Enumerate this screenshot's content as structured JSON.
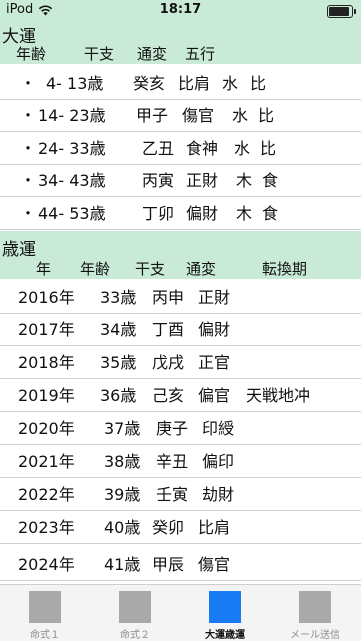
{
  "status": {
    "carrier": "iPod",
    "time": "18:17"
  },
  "daiun": {
    "title": "大運",
    "headers": [
      "年齢",
      "干支",
      "通変",
      "五行"
    ],
    "rows": [
      {
        "age": "4- 13歳",
        "kanshi": "癸亥",
        "tsuhen": "比肩",
        "gogyo": "水",
        "rel": "比"
      },
      {
        "age": "14- 23歳",
        "kanshi": "甲子",
        "tsuhen": "傷官",
        "gogyo": "水",
        "rel": "比"
      },
      {
        "age": "24- 33歳",
        "kanshi": "乙丑",
        "tsuhen": "食神",
        "gogyo": "水",
        "rel": "比"
      },
      {
        "age": "34- 43歳",
        "kanshi": "丙寅",
        "tsuhen": "正財",
        "gogyo": "木",
        "rel": "食"
      },
      {
        "age": "44- 53歳",
        "kanshi": "丁卯",
        "tsuhen": "偏財",
        "gogyo": "木",
        "rel": "食"
      }
    ]
  },
  "saiun": {
    "title": "歳運",
    "headers": [
      "年",
      "年齢",
      "干支",
      "通変",
      "転換期"
    ],
    "rows": [
      {
        "year": "2016年",
        "age": "33歳",
        "kanshi": "丙申",
        "tsuhen": "正財",
        "tenkan": ""
      },
      {
        "year": "2017年",
        "age": "34歳",
        "kanshi": "丁酉",
        "tsuhen": "偏財",
        "tenkan": ""
      },
      {
        "year": "2018年",
        "age": "35歳",
        "kanshi": "戊戌",
        "tsuhen": "正官",
        "tenkan": ""
      },
      {
        "year": "2019年",
        "age": "36歳",
        "kanshi": "己亥",
        "tsuhen": "偏官",
        "tenkan": "天戦地冲"
      },
      {
        "year": "2020年",
        "age": "37歳",
        "kanshi": "庚子",
        "tsuhen": "印綬",
        "tenkan": ""
      },
      {
        "year": "2021年",
        "age": "38歳",
        "kanshi": "辛丑",
        "tsuhen": "偏印",
        "tenkan": ""
      },
      {
        "year": "2022年",
        "age": "39歳",
        "kanshi": "壬寅",
        "tsuhen": "劫財",
        "tenkan": ""
      },
      {
        "year": "2023年",
        "age": "40歳",
        "kanshi": "癸卯",
        "tsuhen": "比肩",
        "tenkan": ""
      },
      {
        "year": "2024年",
        "age": "41歳",
        "kanshi": "甲辰",
        "tsuhen": "傷官",
        "tenkan": ""
      }
    ]
  },
  "tabs": [
    {
      "label": "命式１",
      "active": false
    },
    {
      "label": "命式２",
      "active": false
    },
    {
      "label": "大運歳運",
      "active": true
    },
    {
      "label": "メール送信",
      "active": false
    }
  ],
  "colors": {
    "header_bg": "#c8ead6",
    "active_tab": "#1a7cf5",
    "inactive_icon": "#a9a9a9"
  }
}
